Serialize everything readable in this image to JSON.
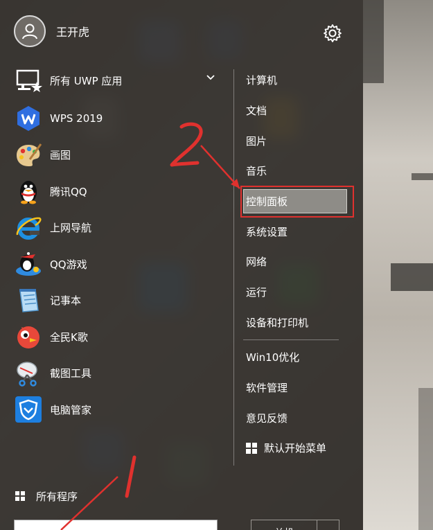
{
  "user": {
    "name": "王开虎"
  },
  "uwp": {
    "label": "所有 UWP 应用"
  },
  "apps": [
    {
      "label": "WPS 2019",
      "icon": "wps-icon"
    },
    {
      "label": "画图",
      "icon": "paint-palette-icon"
    },
    {
      "label": "腾讯QQ",
      "icon": "qq-penguin-icon"
    },
    {
      "label": "上网导航",
      "icon": "ie-browser-icon"
    },
    {
      "label": "QQ游戏",
      "icon": "qq-game-icon"
    },
    {
      "label": "记事本",
      "icon": "notepad-icon"
    },
    {
      "label": "全民K歌",
      "icon": "k-song-icon"
    },
    {
      "label": "截图工具",
      "icon": "snipping-tool-icon"
    },
    {
      "label": "电脑管家",
      "icon": "pc-manager-shield-icon"
    }
  ],
  "places": [
    {
      "label": "计算机"
    },
    {
      "label": "文档"
    },
    {
      "label": "图片"
    },
    {
      "label": "音乐"
    },
    {
      "label": "控制面板",
      "selected": true
    },
    {
      "label": "系统设置"
    },
    {
      "label": "网络"
    },
    {
      "label": "运行"
    },
    {
      "label": "设备和打印机"
    }
  ],
  "extras": [
    {
      "label": "Win10优化"
    },
    {
      "label": "软件管理"
    },
    {
      "label": "意见反馈"
    },
    {
      "label": "默认开始菜单",
      "icon": "windows-logo-icon"
    }
  ],
  "all_programs": {
    "label": "所有程序"
  },
  "shutdown": {
    "label": "关机"
  },
  "search": {
    "value": ""
  },
  "colors": {
    "highlight_box": "#e0312e",
    "annotation": "#e0312e",
    "menu_bg": "#34312d"
  }
}
